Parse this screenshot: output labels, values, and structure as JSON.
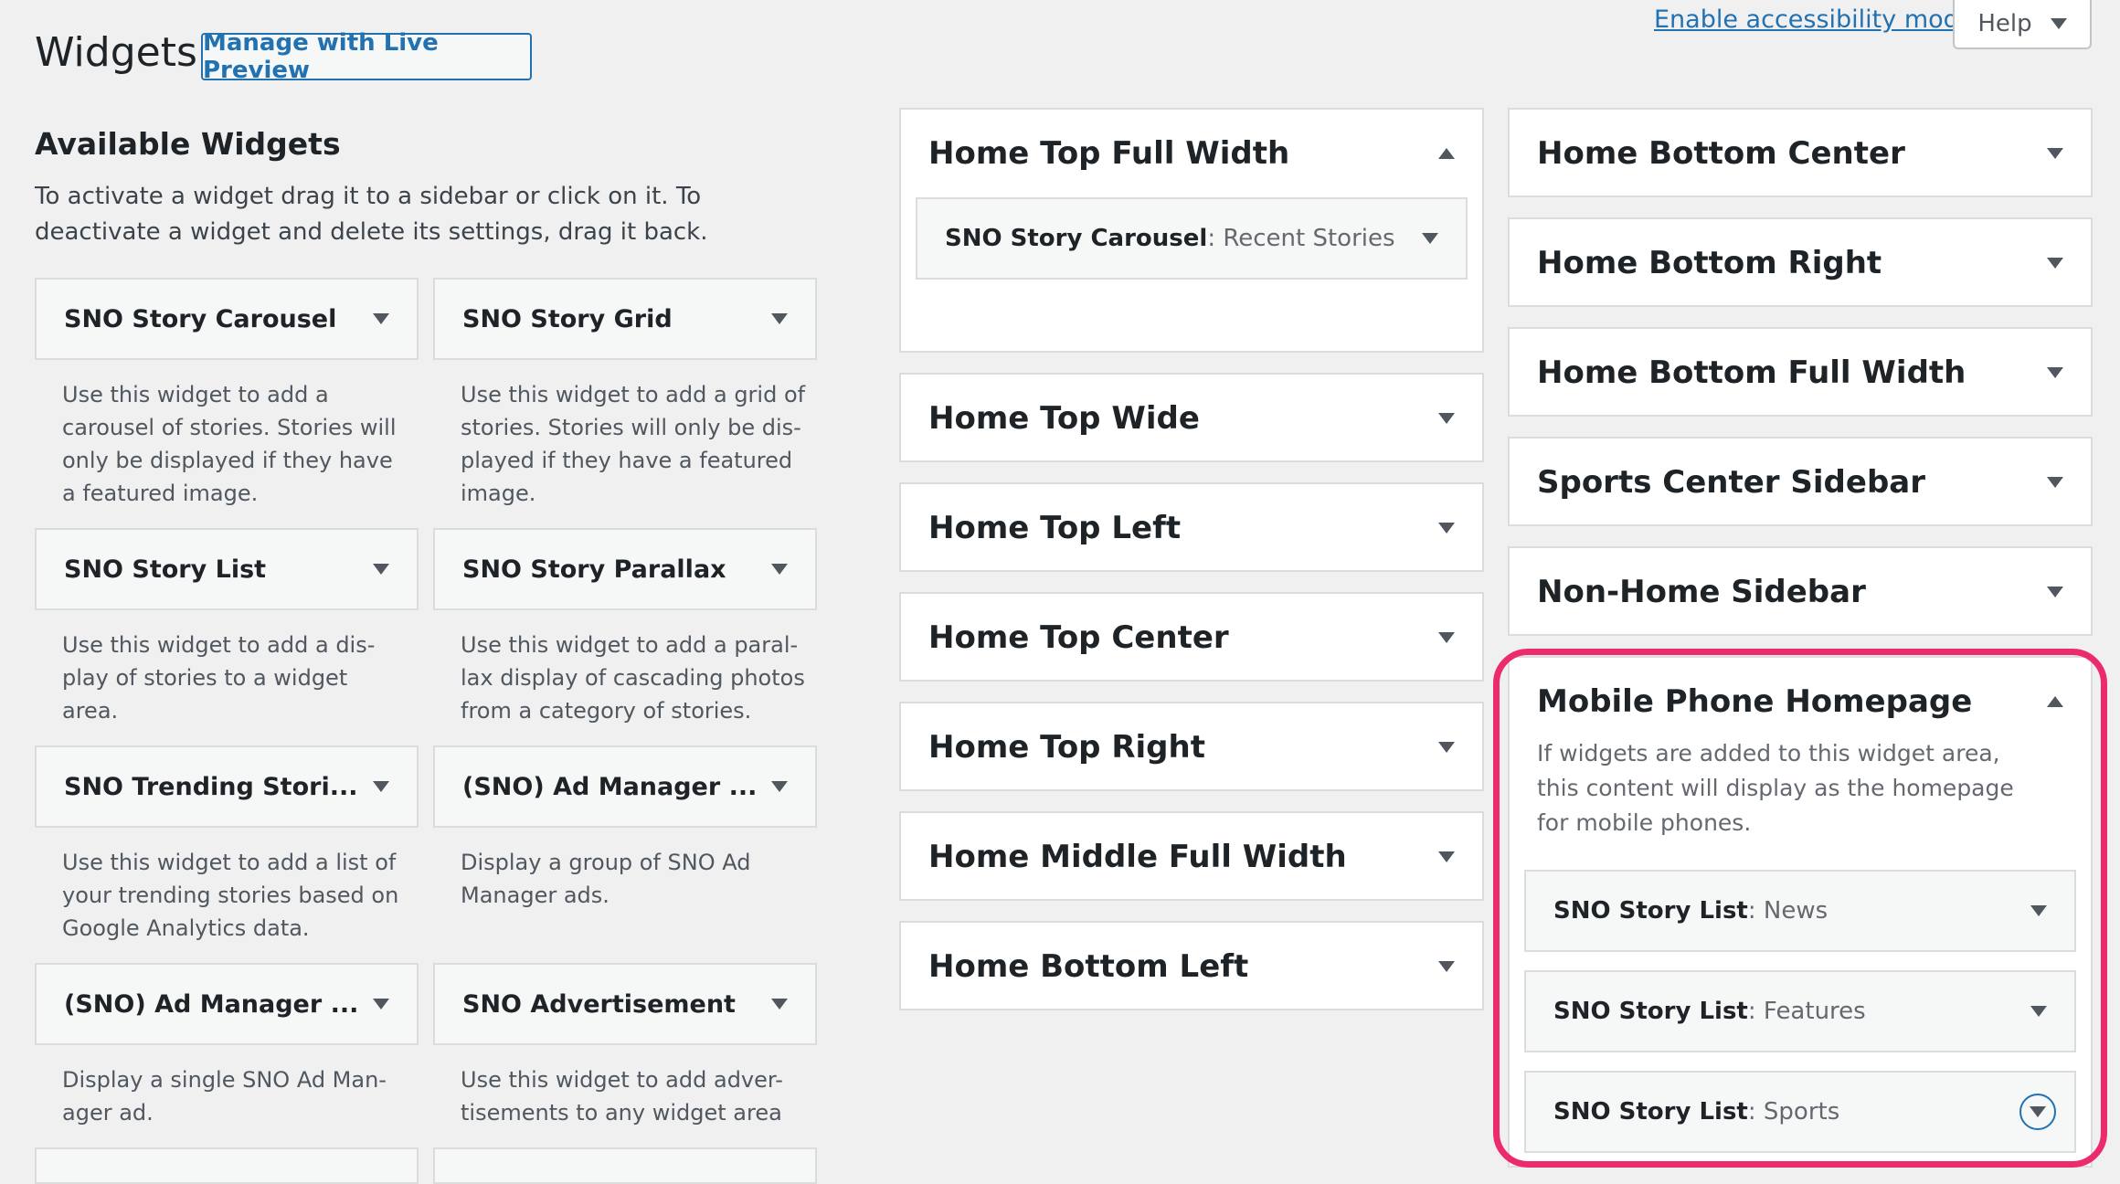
{
  "header": {
    "title": "Widgets",
    "live_preview_label": "Manage with Live Preview",
    "accessibility_link": "Enable accessibility mode",
    "help_label": "Help"
  },
  "available": {
    "title": "Available Widgets",
    "description": "To activate a widget drag it to a sidebar or click on it. To deactivate a widget and delete its settings, drag it back.",
    "widgets": [
      {
        "title": "SNO Story Carousel",
        "desc": "Use this widget to add a carousel of stories. Stories will only be displayed if they have a featured image."
      },
      {
        "title": "SNO Story Grid",
        "desc": "Use this widget to add a grid of stories. Stories will only be dis-played if they have a featured image."
      },
      {
        "title": "SNO Story List",
        "desc": "Use this widget to add a dis-play of stories to a widget area."
      },
      {
        "title": "SNO Story Parallax",
        "desc": "Use this widget to add a paral-lax display of cascading photos from a category of stories."
      },
      {
        "title": "SNO Trending Stori...",
        "desc": "Use this widget to add a list of your trending stories based on Google Analytics data."
      },
      {
        "title": "(SNO) Ad Manager ...",
        "desc": "Display a group of SNO Ad Manager ads."
      },
      {
        "title": "(SNO) Ad Manager ...",
        "desc": "Display a single SNO Ad Man-ager ad."
      },
      {
        "title": "SNO Advertisement",
        "desc": "Use this widget to add adver-tisements to any widget area"
      }
    ]
  },
  "sidebars_col1": [
    {
      "title": "Home Top Full Width",
      "expanded": true,
      "items": [
        {
          "name": "SNO Story Carousel",
          "sub": "Recent Stories"
        }
      ]
    },
    {
      "title": "Home Top Wide"
    },
    {
      "title": "Home Top Left"
    },
    {
      "title": "Home Top Center"
    },
    {
      "title": "Home Top Right"
    },
    {
      "title": "Home Middle Full Width"
    },
    {
      "title": "Home Bottom Left"
    }
  ],
  "sidebars_col2": [
    {
      "title": "Home Bottom Center"
    },
    {
      "title": "Home Bottom Right"
    },
    {
      "title": "Home Bottom Full Width"
    },
    {
      "title": "Sports Center Sidebar"
    },
    {
      "title": "Non-Home Sidebar"
    },
    {
      "title": "Mobile Phone Homepage",
      "expanded": true,
      "description": "If widgets are added to this widget area, this content will display as the homepage for mobile phones.",
      "items": [
        {
          "name": "SNO Story List",
          "sub": "News"
        },
        {
          "name": "SNO Story List",
          "sub": "Features"
        },
        {
          "name": "SNO Story List",
          "sub": "Sports"
        }
      ]
    }
  ],
  "colors": {
    "highlight": "#ec2b6e",
    "link": "#2271b1"
  }
}
